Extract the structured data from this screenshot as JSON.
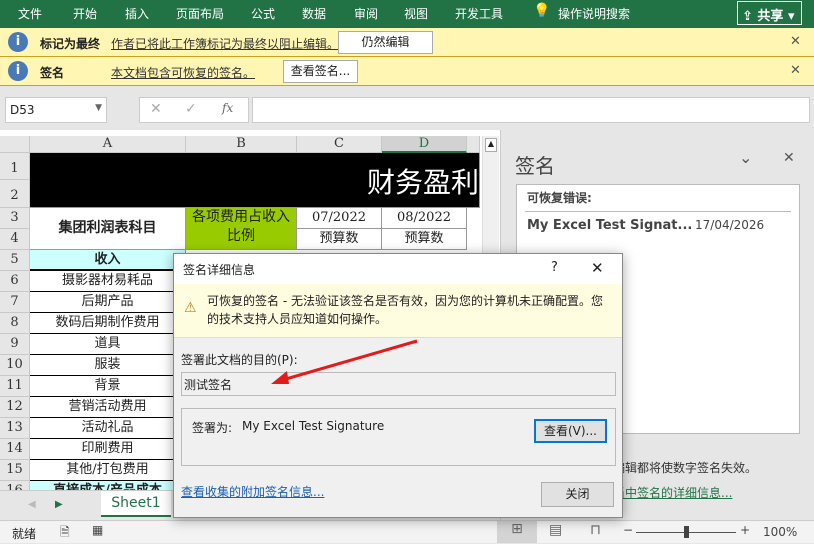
{
  "ribbon": {
    "tabs": [
      "文件",
      "开始",
      "插入",
      "页面布局",
      "公式",
      "数据",
      "审阅",
      "视图",
      "开发工具"
    ],
    "tell_me": "操作说明搜索",
    "share": "共享"
  },
  "bars": [
    {
      "title": "标记为最终",
      "message": "作者已将此工作簿标记为最终以阻止编辑。",
      "button": "仍然编辑"
    },
    {
      "title": "签名",
      "message": "本文档包含可恢复的签名。",
      "button": "查看签名..."
    }
  ],
  "formula": {
    "name_box": "D53",
    "cancel": "✕",
    "enter": "✓",
    "fx": "fx",
    "value": ""
  },
  "sheet": {
    "columns": [
      "A",
      "B",
      "C",
      "D"
    ],
    "rows": [
      "1",
      "2",
      "3",
      "4",
      "5",
      "6",
      "7",
      "8",
      "9",
      "10",
      "11",
      "12",
      "13",
      "14",
      "15",
      "16"
    ],
    "title": "财务盈利",
    "a3": "集团利润表科目",
    "b3": "各项费用占收入比例",
    "c3": "07/2022",
    "d3": "08/2022",
    "c4": "预算数",
    "d4": "预算数",
    "a5": "收入",
    "items": [
      "摄影器材易耗品",
      "后期产品",
      "数码后期制作费用",
      "道具",
      "服装",
      "背景",
      "营销活动费用",
      "活动礼品",
      "印刷费用",
      "其他/打包费用"
    ],
    "a16": "直接成本/产品成本",
    "tab": "Sheet1"
  },
  "pane": {
    "title": "签名",
    "section": "可恢复错误:",
    "sig_name": "My Excel Test Signat...",
    "sig_date": "17/04/2026",
    "note": "编辑都将使数字签名失效。",
    "link": "当中签名的详细信息..."
  },
  "dialog": {
    "title": "签名详细信息",
    "help": "?",
    "warning": "可恢复的签名 - 无法验证该签名是否有效，因为您的计算机未正确配置。您的技术支持人员应知道如何操作。",
    "purpose_label": "签署此文档的目的(P):",
    "purpose": "测试签名",
    "signed_as_label": "签署为:",
    "signed_as": "My Excel Test Signature",
    "view": "查看(V)...",
    "more": "查看收集的附加签名信息...",
    "close": "关闭"
  },
  "status": {
    "ready": "就绪",
    "zoom": "100%",
    "zoom_level": 100
  }
}
